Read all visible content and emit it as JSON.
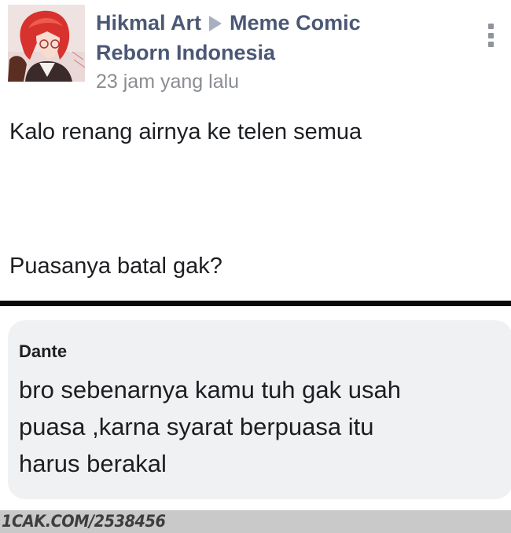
{
  "post": {
    "author": "Hikmal Art",
    "group_line_1": "Meme Comic",
    "group_line_2": "Reborn Indonesia",
    "timestamp": "23 jam yang lalu",
    "text_line_1": "Kalo renang airnya ke telen semua",
    "text_line_2": "Puasanya batal gak?",
    "more_icon": "more-vertical-icon",
    "arrow_icon": "right-triangle-icon"
  },
  "comment": {
    "author": "Dante",
    "lines": [
      "bro sebenarnya kamu tuh gak usah",
      "puasa ,karna syarat berpuasa itu",
      "harus berakal"
    ]
  },
  "footer": {
    "watermark": "1CAK.COM/2538456"
  },
  "colors": {
    "name_link": "#4b5875",
    "meta_gray": "#8a8d91",
    "bubble_bg": "#f0f1f3",
    "divider": "#0a0a0a",
    "watermark_bar": "#c9c9c9"
  }
}
